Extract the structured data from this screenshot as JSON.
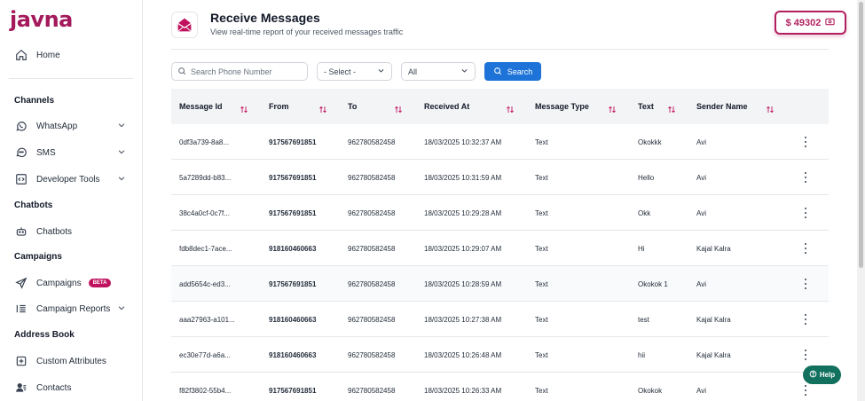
{
  "brand": {
    "logo_text": "javna"
  },
  "sidebar": {
    "home": "Home",
    "channels_heading": "Channels",
    "whatsapp": "WhatsApp",
    "sms": "SMS",
    "developer_tools": "Developer Tools",
    "chatbots_heading": "Chatbots",
    "chatbots": "Chatbots",
    "campaigns_heading": "Campaigns",
    "campaigns": "Campaigns",
    "campaigns_badge": "BETA",
    "campaign_reports": "Campaign Reports",
    "address_book_heading": "Address Book",
    "custom_attributes": "Custom Attributes",
    "contacts": "Contacts"
  },
  "header": {
    "title": "Receive Messages",
    "subtitle": "View real-time report of your received messages traffic",
    "balance": "$ 49302"
  },
  "filters": {
    "search_placeholder": "Search Phone Number",
    "select_value": "- Select -",
    "type_value": "All",
    "search_button": "Search"
  },
  "table": {
    "columns": [
      "Message Id",
      "From",
      "To",
      "Received At",
      "Message Type",
      "Text",
      "Sender Name"
    ],
    "rows": [
      [
        "0df3a739-8a8...",
        "917567691851",
        "962780582458",
        "18/03/2025 10:32:37 AM",
        "Text",
        "Okokkk",
        "Avi"
      ],
      [
        "5a7289dd-b83...",
        "917567691851",
        "962780582458",
        "18/03/2025 10:31:59 AM",
        "Text",
        "Hello",
        "Avi"
      ],
      [
        "38c4a0cf-0c7f...",
        "917567691851",
        "962780582458",
        "18/03/2025 10:29:28 AM",
        "Text",
        "Okk",
        "Avi"
      ],
      [
        "fdb8dec1-7ace...",
        "918160460663",
        "962780582458",
        "18/03/2025 10:29:07 AM",
        "Text",
        "Hi",
        "Kajal Kalra"
      ],
      [
        "add5654c-ed3...",
        "917567691851",
        "962780582458",
        "18/03/2025 10:28:59 AM",
        "Text",
        "Okokok 1",
        "Avi"
      ],
      [
        "aaa27963-a101...",
        "918160460663",
        "962780582458",
        "18/03/2025 10:27:38 AM",
        "Text",
        "test",
        "Kajal Kalra"
      ],
      [
        "ec30e77d-a6a...",
        "918160460663",
        "962780582458",
        "18/03/2025 10:26:48 AM",
        "Text",
        "hii",
        "Kajal Kalra"
      ],
      [
        "f82f3802-55b4...",
        "917567691851",
        "962780582458",
        "18/03/2025 10:26:33 AM",
        "Text",
        "Okokok",
        "Avi"
      ]
    ]
  },
  "help": {
    "label": "Help"
  },
  "colors": {
    "brand": "#a3195b",
    "accent": "#1d73d8",
    "help": "#12705e"
  }
}
